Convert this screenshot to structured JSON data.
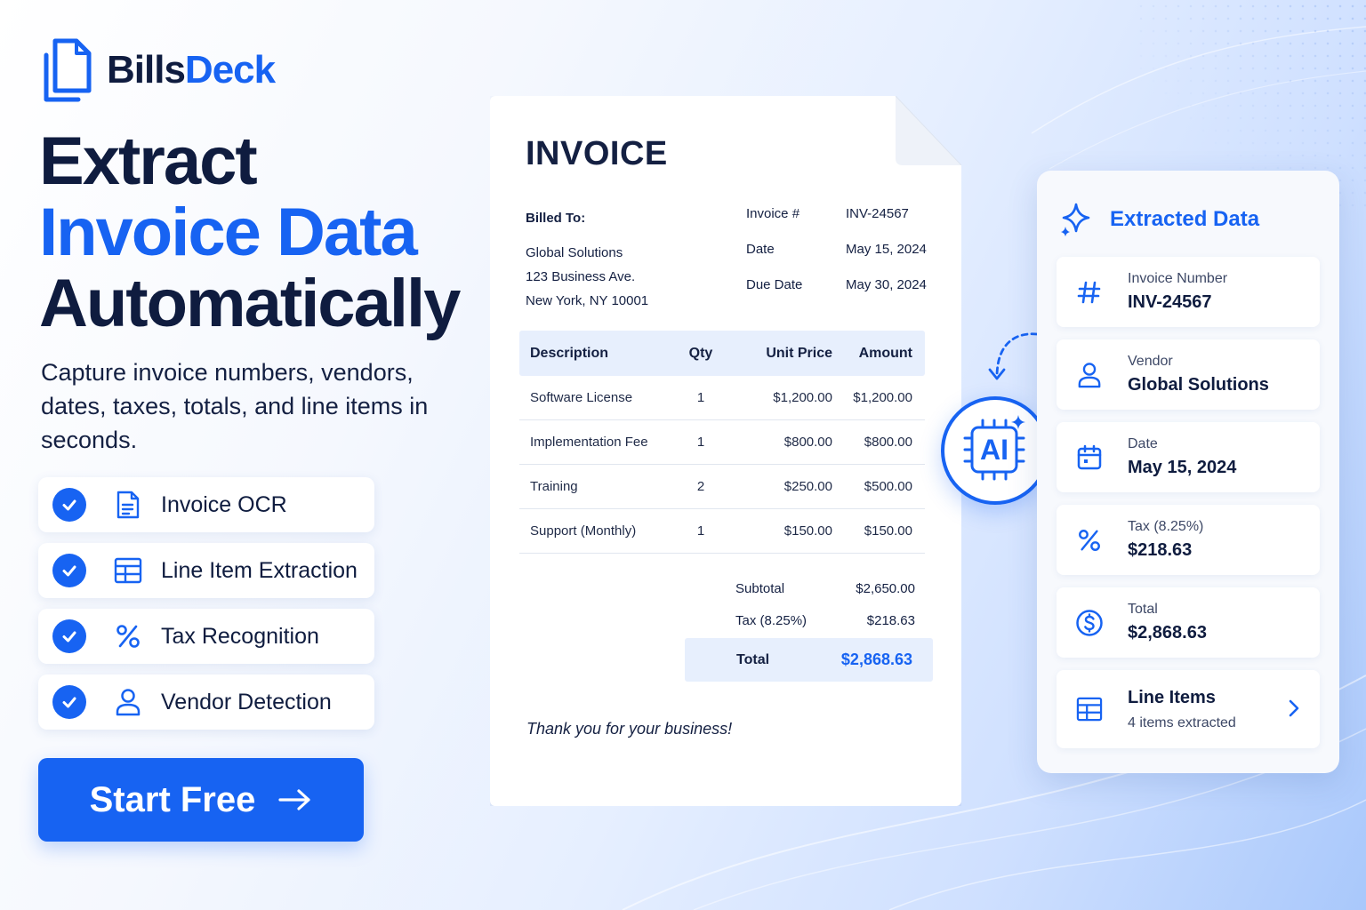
{
  "brand": {
    "name_part1": "Bills",
    "name_part2": "Deck"
  },
  "hero": {
    "line1": "Extract",
    "line2": "Invoice Data",
    "line3": "Automatically",
    "subtitle": "Capture invoice numbers, vendors, dates, taxes, totals, and line items in seconds."
  },
  "features": [
    {
      "label": "Invoice OCR",
      "icon": "document-icon"
    },
    {
      "label": "Line Item Extraction",
      "icon": "table-icon"
    },
    {
      "label": "Tax Recognition",
      "icon": "percent-icon"
    },
    {
      "label": "Vendor Detection",
      "icon": "user-icon"
    }
  ],
  "cta": {
    "label": "Start Free",
    "icon": "arrow-right-icon"
  },
  "invoice": {
    "title": "INVOICE",
    "billed_to_label": "Billed To:",
    "billed_to": [
      "Global Solutions",
      "123 Business Ave.",
      "New York, NY 10001"
    ],
    "meta": [
      {
        "label": "Invoice #",
        "value": "INV-24567"
      },
      {
        "label": "Date",
        "value": "May 15, 2024"
      },
      {
        "label": "Due Date",
        "value": "May 30, 2024"
      }
    ],
    "columns": [
      "Description",
      "Qty",
      "Unit Price",
      "Amount"
    ],
    "items": [
      {
        "description": "Software License",
        "qty": "1",
        "unit_price": "$1,200.00",
        "amount": "$1,200.00"
      },
      {
        "description": "Implementation Fee",
        "qty": "1",
        "unit_price": "$800.00",
        "amount": "$800.00"
      },
      {
        "description": "Training",
        "qty": "2",
        "unit_price": "$250.00",
        "amount": "$500.00"
      },
      {
        "description": "Support (Monthly)",
        "qty": "1",
        "unit_price": "$150.00",
        "amount": "$150.00"
      }
    ],
    "subtotal_label": "Subtotal",
    "subtotal": "$2,650.00",
    "tax_label": "Tax (8.25%)",
    "tax": "$218.63",
    "total_label": "Total",
    "total": "$2,868.63",
    "thanks": "Thank you for your business!"
  },
  "ai_badge": {
    "text": "AI",
    "icon": "ai-chip-icon"
  },
  "extracted": {
    "title": "Extracted Data",
    "icon": "sparkle-icon",
    "fields": [
      {
        "label": "Invoice Number",
        "value": "INV-24567",
        "icon": "hash-icon"
      },
      {
        "label": "Vendor",
        "value": "Global Solutions",
        "icon": "user-icon"
      },
      {
        "label": "Date",
        "value": "May 15, 2024",
        "icon": "calendar-icon"
      },
      {
        "label": "Tax (8.25%)",
        "value": "$218.63",
        "icon": "percent-icon"
      },
      {
        "label": "Total",
        "value": "$2,868.63",
        "icon": "dollar-icon"
      }
    ],
    "line_items": {
      "label": "Line Items",
      "sub": "4 items extracted",
      "icon": "table-icon"
    }
  },
  "colors": {
    "accent": "#1763f2",
    "dark": "#0f1c3f",
    "panel": "#f7f9fd",
    "highlight": "#e7effd"
  }
}
